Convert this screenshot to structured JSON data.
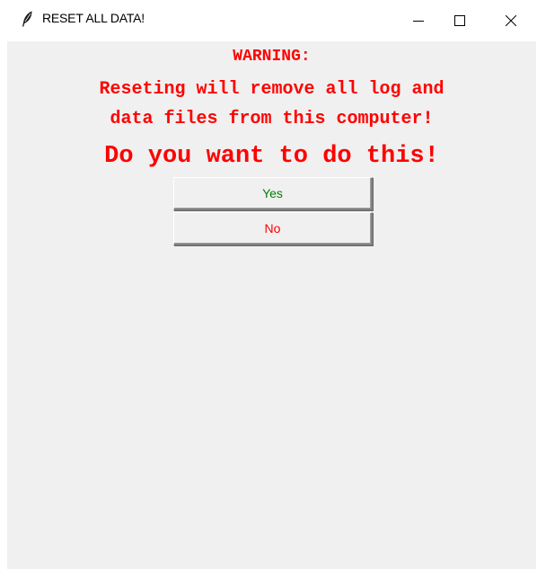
{
  "window": {
    "title": "RESET ALL DATA!",
    "icon": "feather-icon",
    "controls": {
      "minimize": "minimize-icon",
      "maximize": "maximize-icon",
      "close": "close-icon"
    }
  },
  "message": {
    "warning": "WARNING:",
    "line1": "Reseting will remove all log and",
    "line2": "data files from this computer!",
    "question": "Do you want to do this!"
  },
  "buttons": {
    "yes_label": "Yes",
    "no_label": "No"
  },
  "colors": {
    "message_text": "#ff0000",
    "yes_text": "#008000",
    "no_text": "#ff0000",
    "client_background": "#f0f0f0"
  }
}
